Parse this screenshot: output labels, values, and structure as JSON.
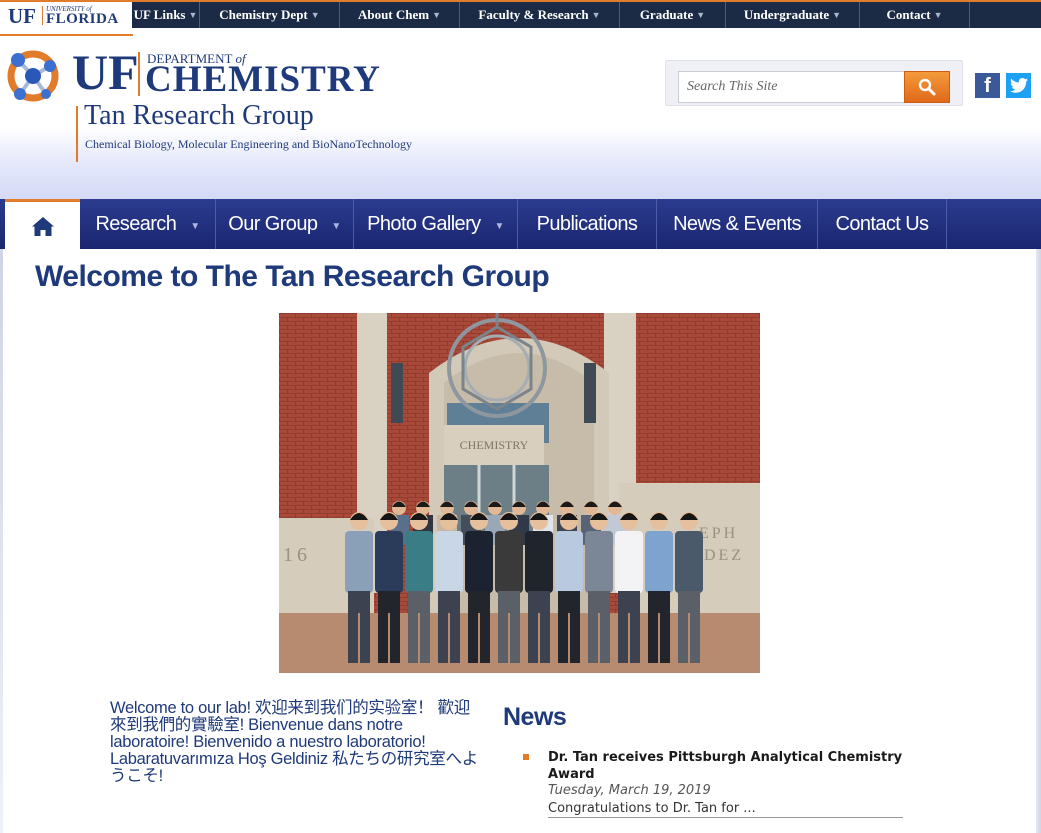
{
  "topbar": {
    "logo_uf": "UF",
    "logo_small": "UNIVERSITY of",
    "logo_big": "FLORIDA",
    "links": [
      {
        "label": "UF Links",
        "has_menu": true
      },
      {
        "label": "Chemistry Dept",
        "has_menu": true
      },
      {
        "label": "About Chem",
        "has_menu": true
      },
      {
        "label": "Faculty & Research",
        "has_menu": true
      },
      {
        "label": "Graduate",
        "has_menu": true
      },
      {
        "label": "Undergraduate",
        "has_menu": true
      },
      {
        "label": "Contact",
        "has_menu": true
      }
    ]
  },
  "header": {
    "uf": "UF",
    "department_label": "DEPARTMENT",
    "department_of": "of",
    "chemistry": "CHEMISTRY",
    "group_title": "Tan Research Group",
    "group_subtitle": "Chemical Biology, Molecular Engineering and BioNanoTechnology"
  },
  "search": {
    "placeholder": "Search This Site",
    "button_icon": "search-icon"
  },
  "social": {
    "facebook": "f",
    "icons": [
      "facebook-icon",
      "twitter-icon"
    ]
  },
  "nav": {
    "home_icon": "home-icon",
    "items": [
      {
        "label": "Research",
        "has_menu": true
      },
      {
        "label": "Our Group",
        "has_menu": true
      },
      {
        "label": "Photo Gallery",
        "has_menu": true
      },
      {
        "label": "Publications",
        "has_menu": false
      },
      {
        "label": "News & Events",
        "has_menu": false
      },
      {
        "label": "Contact Us",
        "has_menu": false
      }
    ]
  },
  "main": {
    "title": "Welcome to The Tan Research Group",
    "photo": {
      "building_sign": "CHEMISTRY",
      "number_left": "16",
      "engraving_line1": "EPH",
      "engraving_line2": "DEZ"
    },
    "welcome_text": "Welcome to our lab! 欢迎来到我们的实验室！ 歡迎來到我們的實驗室! Bienvenue dans notre laboratoire! Bienvenido a nuestro laboratorio! Labaratuvarımıza Hoş Geldiniz 私たちの研究室へようこそ!"
  },
  "news": {
    "title": "News",
    "items": [
      {
        "headline": "Dr. Tan receives Pittsburgh Analytical Chemistry Award",
        "date": "Tuesday, March 19, 2019",
        "snippet": "Congratulations to Dr. Tan for ..."
      }
    ]
  },
  "colors": {
    "navy": "#1f3a7a",
    "orange": "#e07c2c",
    "nav_blue": "#22307f",
    "topbar": "#1b2b45"
  }
}
